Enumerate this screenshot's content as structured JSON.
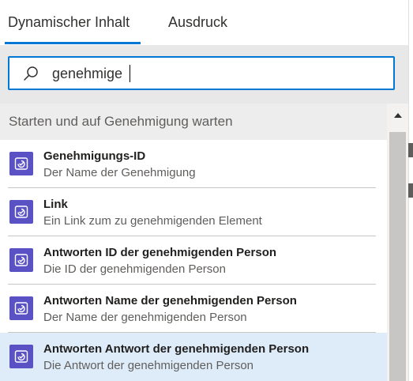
{
  "tabs": [
    {
      "label": "Dynamischer Inhalt",
      "active": true
    },
    {
      "label": "Ausdruck",
      "active": false
    }
  ],
  "search": {
    "value": "genehmige",
    "placeholder": ""
  },
  "section": {
    "title": "Starten und auf Genehmigung warten"
  },
  "items": [
    {
      "title": "Genehmigungs-ID",
      "subtitle": "Der Name der Genehmigung",
      "icon": "approval-icon"
    },
    {
      "title": "Link",
      "subtitle": "Ein Link zum zu genehmigenden Element",
      "icon": "approval-icon"
    },
    {
      "title": "Antworten ID der genehmigenden Person",
      "subtitle": "Die ID der genehmigenden Person",
      "icon": "approval-icon"
    },
    {
      "title": "Antworten Name der genehmigenden Person",
      "subtitle": "Der Name der genehmigenden Person",
      "icon": "approval-icon"
    },
    {
      "title": "Antworten Antwort der genehmigenden Person",
      "subtitle": "Die Antwort der genehmigenden Person",
      "icon": "approval-icon",
      "selected": true
    }
  ],
  "colors": {
    "accent": "#0078d4",
    "icon_bg": "#5a52c4",
    "selected_bg": "#deecf9"
  }
}
